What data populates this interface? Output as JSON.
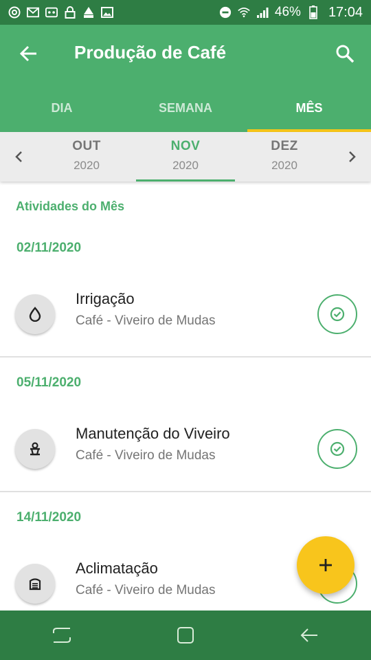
{
  "status_bar": {
    "battery_percent": "46%",
    "time": "17:04",
    "icons": [
      "chrome-icon",
      "gmail-icon",
      "voicemail-icon",
      "lock-icon",
      "mm-app-icon",
      "image-icon",
      "do-not-disturb-icon",
      "wifi-icon",
      "signal-icon",
      "battery-icon"
    ]
  },
  "app_bar": {
    "title": "Produção de Café",
    "back_icon": "arrow-back-icon",
    "search_icon": "search-icon"
  },
  "tabs": [
    {
      "label": "DIA",
      "active": false
    },
    {
      "label": "SEMANA",
      "active": false
    },
    {
      "label": "MÊS",
      "active": true
    }
  ],
  "month_selector": {
    "months": [
      {
        "name": "OUT",
        "year": "2020",
        "active": false
      },
      {
        "name": "NOV",
        "year": "2020",
        "active": true
      },
      {
        "name": "DEZ",
        "year": "2020",
        "active": false
      }
    ]
  },
  "content": {
    "section_title": "Atividades do Mês",
    "groups": [
      {
        "date": "02/11/2020",
        "activity": {
          "title": "Irrigação",
          "subtitle": "Café - Viveiro de Mudas",
          "icon": "water-drop-icon",
          "completed": true
        }
      },
      {
        "date": "05/11/2020",
        "activity": {
          "title": "Manutenção do Viveiro",
          "subtitle": "Café - Viveiro de Mudas",
          "icon": "seedling-pot-icon",
          "completed": true
        }
      },
      {
        "date": "14/11/2020",
        "activity": {
          "title": "Aclimatação",
          "subtitle": "Café - Viveiro de Mudas",
          "icon": "greenhouse-icon",
          "completed": true
        }
      }
    ]
  },
  "fab": {
    "symbol": "+"
  },
  "colors": {
    "primary": "#4caf6e",
    "primary_dark": "#2e7d44",
    "accent": "#f8c51c",
    "tab_indicator": "#f5c518"
  }
}
